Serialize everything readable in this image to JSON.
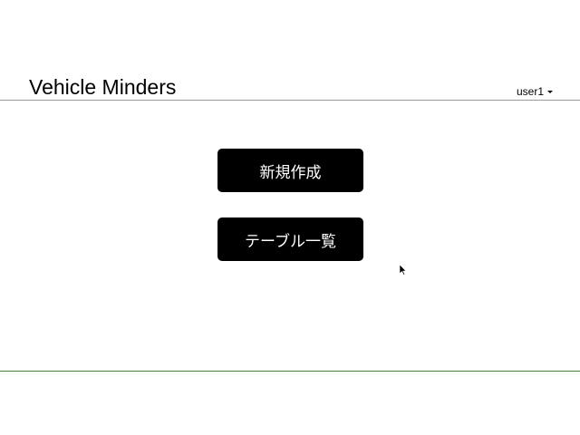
{
  "header": {
    "brand": "Vehicle Minders",
    "user_menu": "user1"
  },
  "main": {
    "buttons": [
      {
        "label": "新規作成"
      },
      {
        "label": "テーブル一覧"
      }
    ]
  },
  "colors": {
    "footer_line": "#4a7a3a",
    "button_bg": "#000000"
  }
}
